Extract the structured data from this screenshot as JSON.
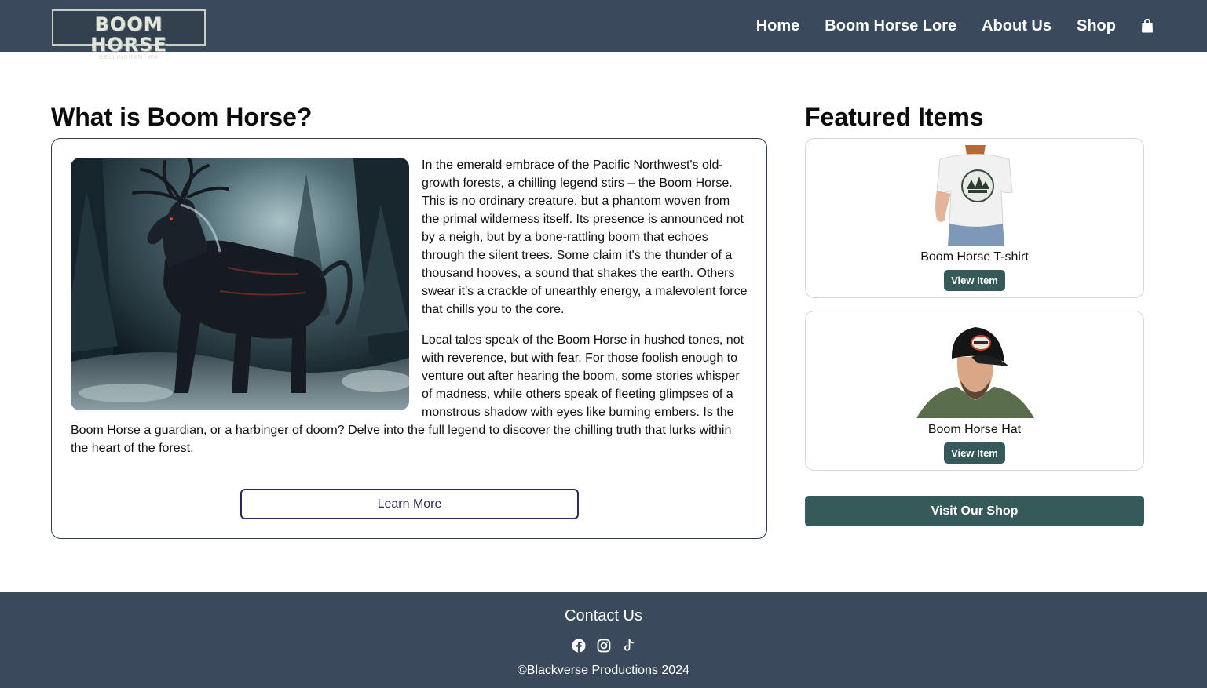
{
  "header": {
    "logo": {
      "main": "BOOM HORSE",
      "sub": "-BELLINGHAM, WA-"
    },
    "nav": [
      {
        "label": "Home"
      },
      {
        "label": "Boom Horse Lore"
      },
      {
        "label": "About Us"
      },
      {
        "label": "Shop"
      }
    ],
    "cart_icon": "shopping-bag-icon"
  },
  "about": {
    "title": "What is Boom Horse?",
    "paragraphs": [
      "In the emerald embrace of the Pacific Northwest's old-growth forests, a chilling legend stirs – the Boom Horse. This is no ordinary creature, but a phantom woven from the primal wilderness itself. Its presence is announced not by a neigh, but by a bone-rattling boom that echoes through the silent trees. Some claim it's the thunder of a thousand hooves, a sound that shakes the earth. Others swear it's a crackle of unearthly energy, a malevolent force that chills you to the core.",
      "Local tales speak of the Boom Horse in hushed tones, not with reverence, but with fear. For those foolish enough to venture out after hearing the boom, some stories whisper of madness, while others speak of fleeting glimpses of a monstrous shadow with eyes like burning embers. Is the Boom Horse a guardian, or a harbinger of doom? Delve into the full legend to discover the chilling truth that lurks within the heart of the forest."
    ],
    "learn_more_label": "Learn More"
  },
  "featured": {
    "title": "Featured Items",
    "items": [
      {
        "name": "Boom Horse T-shirt",
        "button": "View Item"
      },
      {
        "name": "Boom Horse Hat",
        "button": "View Item"
      }
    ],
    "shop_button": "Visit Our Shop"
  },
  "footer": {
    "title": "Contact Us",
    "social_icons": [
      "facebook-icon",
      "instagram-icon",
      "tiktok-icon"
    ],
    "copyright": "©Blackverse Productions 2024"
  },
  "colors": {
    "navbar": "#3a4a5c",
    "accent_button": "#36595a",
    "outline_button": "#2c2a55"
  }
}
